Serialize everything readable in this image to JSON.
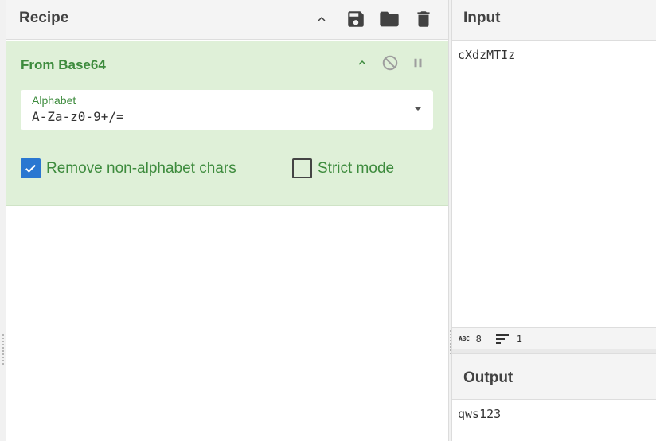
{
  "recipe": {
    "title": "Recipe",
    "operation": {
      "name": "From Base64",
      "alphabet_label": "Alphabet",
      "alphabet_value": "A-Za-z0-9+/=",
      "remove_non_alphabet": {
        "label": "Remove non-alphabet chars",
        "checked": true
      },
      "strict_mode": {
        "label": "Strict mode",
        "checked": false
      }
    },
    "header_icons": [
      "chevron-up-icon",
      "save-icon",
      "folder-icon",
      "trash-icon"
    ],
    "operation_icons": [
      "chevron-up-icon",
      "disable-icon",
      "pause-icon"
    ]
  },
  "input": {
    "title": "Input",
    "value": "cXdzMTIz",
    "status": {
      "abc_label": "ABC",
      "length": "8",
      "lines": "1"
    }
  },
  "output": {
    "title": "Output",
    "value": "qws123"
  },
  "colors": {
    "operation_bg": "#dff0d8",
    "operation_text": "#3d8b3d",
    "checkbox_accent": "#2a77d1",
    "header_bg": "#f4f4f4"
  }
}
